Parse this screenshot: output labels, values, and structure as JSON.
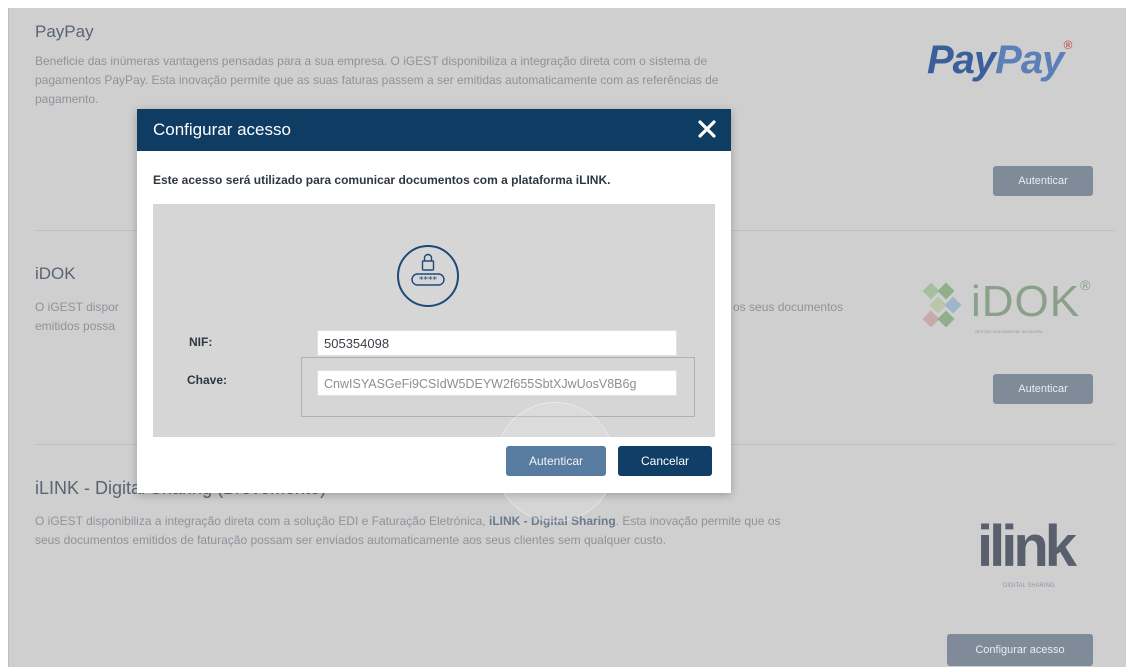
{
  "sections": {
    "paypay": {
      "title": "PayPay",
      "desc_line1": "Beneficie das inúmeras vantagens pensadas para a sua empresa. O iGEST disponibiliza a integração direta com o sistema de",
      "desc_line2": "pagamentos PayPay. Esta inovação permite que as suas faturas passem a ser emitidas automaticamente com as referências de",
      "desc_line3": "pagamento.",
      "button": "Autenticar",
      "logo_text_a": "Pay",
      "logo_text_b": "Pay",
      "logo_reg": "®"
    },
    "idok": {
      "title": "iDOK",
      "desc_line1_left": "O iGEST dispor",
      "desc_line1_right": "e os seus documentos",
      "desc_line2_left": "emitidos possa",
      "button": "Autenticar",
      "logo_text": "iDOK",
      "logo_reg": "®",
      "logo_sub": "GESTÃO DOCUMENTAL NA NUVEM"
    },
    "ilink": {
      "title": "iLINK - Digital Sharing (Brevemente)",
      "desc_line1_a": "O iGEST disponibiliza a integração direta com a solução EDI e Faturação Eletrónica, ",
      "desc_line1_bold": "iLINK - Digital Sharing",
      "desc_line1_b": ". Esta inovação permite que os",
      "desc_line2": "seus documentos emitidos de faturação possam ser enviados automaticamente aos seus clientes sem qualquer custo.",
      "button": "Configurar acesso",
      "logo_text": "ilink",
      "logo_sub": "DIGITAL SHARING"
    }
  },
  "modal": {
    "title": "Configurar acesso",
    "close_glyph": "✕",
    "intro": "Este acesso será utilizado para comunicar documentos com a plataforma iLINK.",
    "lock_stars": "****",
    "nif_label": "NIF:",
    "nif_value": "505354098",
    "key_label": "Chave:",
    "key_value": "CnwISYASGeFi9CSIdW5DEYW2f655SbtXJwUosV8B6g",
    "auth_button": "Autenticar",
    "cancel_button": "Cancelar"
  },
  "colors": {
    "header": "#0f3c63",
    "primary_button": "#3d6791",
    "cancel_button": "#113e66",
    "overlay": "#cfcfcf"
  }
}
